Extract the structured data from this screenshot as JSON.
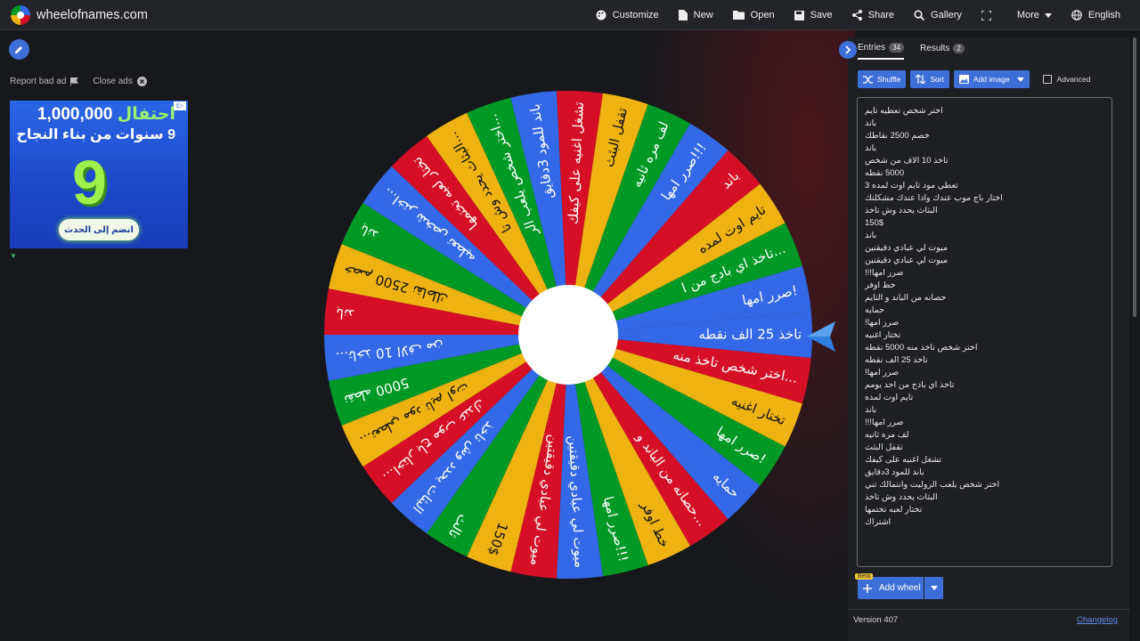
{
  "topbar": {
    "site_name": "wheelofnames.com",
    "nav": {
      "customize": "Customize",
      "new": "New",
      "open": "Open",
      "save": "Save",
      "share": "Share",
      "gallery": "Gallery",
      "more": "More",
      "language": "English"
    }
  },
  "left": {
    "report_ad": "Report bad ad",
    "close_ads": "Close ads",
    "ad": {
      "line1_green": "احتفال",
      "line1_number": "1,000,000",
      "line2": "9 سنوات من بناء النجاح",
      "big": "9",
      "cta": "انضم إلى الحدث",
      "info": "i▷"
    }
  },
  "wheel": {
    "colors": [
      "#3369e8",
      "#d50f25",
      "#eeb211",
      "#009925"
    ],
    "segments": [
      "تاخذ 25 الف نقطه",
      "اختر شخص تاخذ منه...",
      "تختار اغنيه",
      "صرر امها!",
      "حمايه",
      "حصانه من الباند و...",
      "خط اوفر",
      "صرر امها!!!",
      "ميوت لي عبادي دقيقتين",
      "ميوت لي عبادي دقيقتين",
      "150$",
      "ثالث",
      "البثاث يحدد وش تاخذ",
      "اختار باج موب عندك...",
      "تعطي مود تايم اوت...",
      "5000 نقطه",
      "تاخذ 10 الاف من...",
      "باند",
      "خصم 2500 نقاطك",
      "باند",
      "اختر شخص تعطيه...",
      "تختار لعبه تختمها",
      "البثاث يحدد وش تا...",
      "اختر شخص يلعب الر...",
      "باند للمود 3دقايق",
      "تشغل اغنيه على كيفك",
      "تقفل البثث",
      "لف مره ثانيه",
      "صرر امها!!!",
      "باند",
      "تايم اوت لمده",
      "تاخذ اي بادج من ا...",
      "صرر امها!"
    ]
  },
  "panel": {
    "tab_entries": "Entries",
    "entries_count": "34",
    "tab_results": "Results",
    "results_count": "2",
    "shuffle": "Shuffle",
    "sort": "Sort",
    "add_image": "Add image",
    "advanced": "Advanced",
    "entries": [
      "اختر شخص تعطيه تايم",
      "باند",
      "خصم 2500 نقاطك",
      "باند",
      "تاخذ 10 الاف من شخص",
      "5000 نقطه",
      "تعطي مود تايم اوت لمده 3",
      "اختار باج موب عندك وادا عندك مشكلتك",
      "البثاث يحدد وش تاخذ",
      "150$",
      "باند",
      "ميوت لي عبادي دقيقتين",
      "ميوت لي عبادي دقيقتين",
      "صرر امها!!!",
      "خط اوفر",
      "حصانه من الباند و التايم",
      "حمايه",
      "صرر امها!",
      "تختار اغنيه",
      "اختر شخص تاخذ منه 5000 نقطه",
      "تاخذ 25 الف نقطه",
      "صرر امها!",
      "تاخذ اي بادج من احد يومم",
      "تايم اوت لمده",
      "باند",
      "صرر امها!!!",
      "لف مره ثانيه",
      "تقفل البثث",
      "تشغل اغنيه على كيفك",
      "باند للمود 3دقايق",
      "اختر شخص يلعب الروليت وانتمالك تني",
      "البثاث يحدد وش تاخذ",
      "تختار لعبه تختمها",
      "اشتراك"
    ],
    "beta": "Beta",
    "add_wheel": "Add wheel",
    "version": "Version 407",
    "changelog": "Changelog"
  }
}
